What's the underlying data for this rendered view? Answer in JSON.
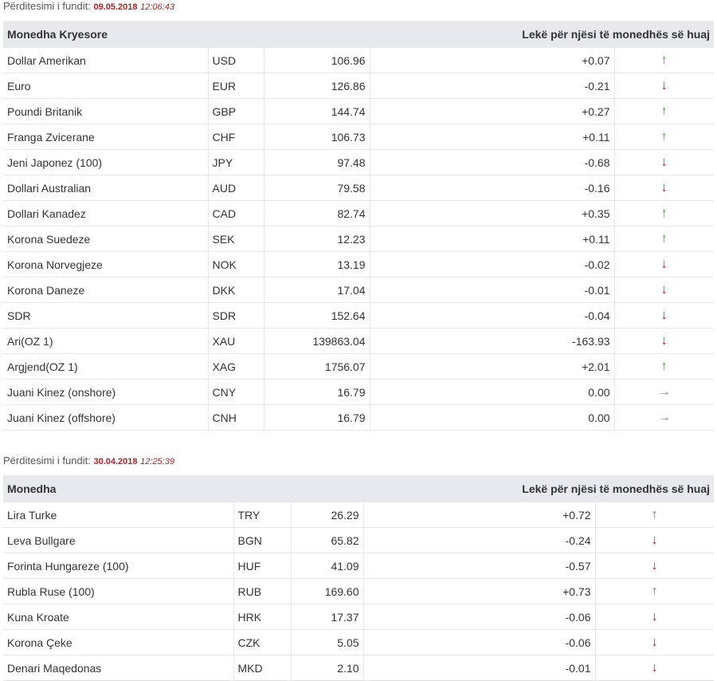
{
  "update1": {
    "label": "Përditesimi i fundit:",
    "date": "09.05.2018",
    "time": "12:06:43"
  },
  "table1": {
    "header_name": "Monedha Kryesore",
    "header_value": "Lekë për njësi të monedhës së huaj",
    "rows": [
      {
        "name": "Dollar Amerikan",
        "code": "USD",
        "rate": "106.96",
        "change": "+0.07",
        "dir": "up"
      },
      {
        "name": "Euro",
        "code": "EUR",
        "rate": "126.86",
        "change": "-0.21",
        "dir": "down"
      },
      {
        "name": "Poundi Britanik",
        "code": "GBP",
        "rate": "144.74",
        "change": "+0.27",
        "dir": "up"
      },
      {
        "name": "Franga Zvicerane",
        "code": "CHF",
        "rate": "106.73",
        "change": "+0.11",
        "dir": "up"
      },
      {
        "name": "Jeni Japonez (100)",
        "code": "JPY",
        "rate": "97.48",
        "change": "-0.68",
        "dir": "down"
      },
      {
        "name": "Dollari Australian",
        "code": "AUD",
        "rate": "79.58",
        "change": "-0.16",
        "dir": "down"
      },
      {
        "name": "Dollari Kanadez",
        "code": "CAD",
        "rate": "82.74",
        "change": "+0.35",
        "dir": "up"
      },
      {
        "name": "Korona Suedeze",
        "code": "SEK",
        "rate": "12.23",
        "change": "+0.11",
        "dir": "up"
      },
      {
        "name": "Korona Norvegjeze",
        "code": "NOK",
        "rate": "13.19",
        "change": "-0.02",
        "dir": "down"
      },
      {
        "name": "Korona Daneze",
        "code": "DKK",
        "rate": "17.04",
        "change": "-0.01",
        "dir": "down"
      },
      {
        "name": "SDR",
        "code": "SDR",
        "rate": "152.64",
        "change": "-0.04",
        "dir": "down"
      },
      {
        "name": "Ari(OZ 1)",
        "code": "XAU",
        "rate": "139863.04",
        "change": "-163.93",
        "dir": "down"
      },
      {
        "name": "Argjend(OZ 1)",
        "code": "XAG",
        "rate": "1756.07",
        "change": "+2.01",
        "dir": "up"
      },
      {
        "name": "Juani Kinez (onshore)",
        "code": "CNY",
        "rate": "16.79",
        "change": "0.00",
        "dir": "flat"
      },
      {
        "name": "Juani Kinez (offshore)",
        "code": "CNH",
        "rate": "16.79",
        "change": "0.00",
        "dir": "flat"
      }
    ]
  },
  "update2": {
    "label": "Përditesimi i fundit:",
    "date": "30.04.2018",
    "time": "12:25:39"
  },
  "table2": {
    "header_name": "Monedha",
    "header_value": "Lekë për njësi të monedhës së huaj",
    "rows": [
      {
        "name": "Lira Turke",
        "code": "TRY",
        "rate": "26.29",
        "change": "+0.72",
        "dir": "up"
      },
      {
        "name": "Leva Bullgare",
        "code": "BGN",
        "rate": "65.82",
        "change": "-0.24",
        "dir": "down"
      },
      {
        "name": "Forinta Hungareze (100)",
        "code": "HUF",
        "rate": "41.09",
        "change": "-0.57",
        "dir": "down"
      },
      {
        "name": "Rubla Ruse (100)",
        "code": "RUB",
        "rate": "169.60",
        "change": "+0.73",
        "dir": "up"
      },
      {
        "name": "Kuna Kroate",
        "code": "HRK",
        "rate": "17.37",
        "change": "-0.06",
        "dir": "down"
      },
      {
        "name": "Korona Çeke",
        "code": "CZK",
        "rate": "5.05",
        "change": "-0.06",
        "dir": "down"
      },
      {
        "name": "Denari Maqedonas",
        "code": "MKD",
        "rate": "2.10",
        "change": "-0.01",
        "dir": "down"
      }
    ]
  }
}
